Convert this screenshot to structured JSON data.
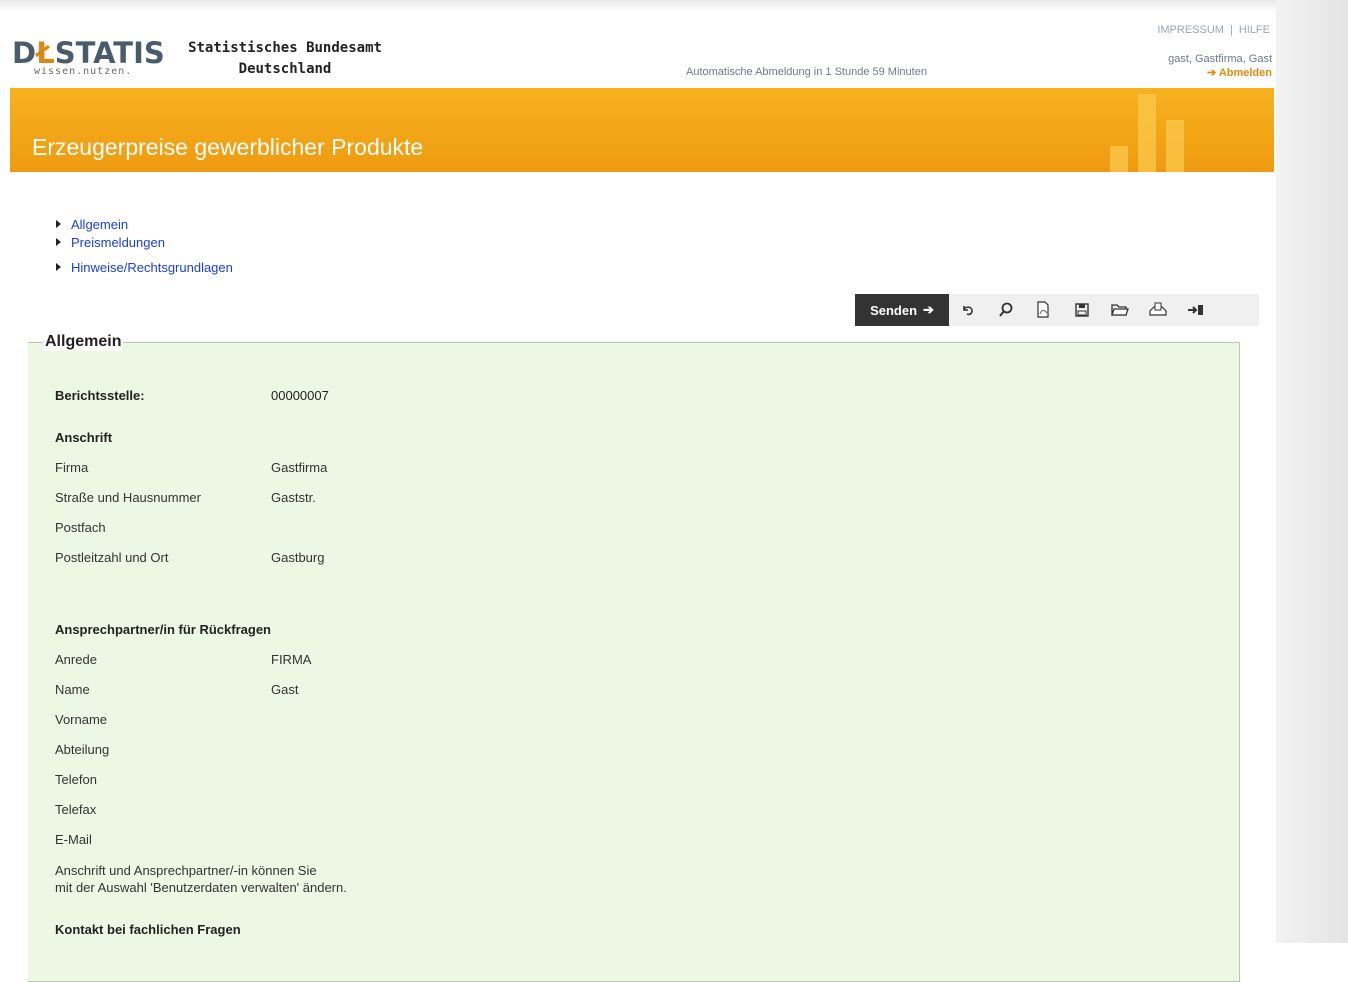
{
  "header": {
    "logo_text_1": "D",
    "logo_text_accent": "Ł",
    "logo_text_2": "STATIS",
    "logo_subtitle": "wissen.nutzen.",
    "org_line1": "Statistisches Bundesamt",
    "org_line2": "Deutschland",
    "impressum": "IMPRESSUM",
    "separator": "|",
    "hilfe": "HILFE",
    "auto_logout": "Automatische Abmeldung in 1 Stunde 59 Minuten",
    "user": "gast, Gastfirma, Gast",
    "logout": "➔ Abmelden"
  },
  "banner": {
    "title": "Erzeugerpreise gewerblicher Produkte"
  },
  "nav": {
    "items": [
      {
        "label": "Allgemein"
      },
      {
        "label": "Preismeldungen"
      },
      {
        "label": "Hinweise/Rechtsgrundlagen"
      }
    ]
  },
  "toolbar": {
    "send_label": "Senden",
    "send_arrow": "➔",
    "undo_icon": "↶",
    "search_icon": "⌕",
    "pdf_icon": "⎗",
    "save_icon": "⊟",
    "open_icon": "❐",
    "print_icon": "⎙",
    "exit_icon": "➜▌"
  },
  "section": {
    "legend": "Allgemein",
    "berichtsstelle_label": "Berichtsstelle:",
    "berichtsstelle_value": "00000007",
    "anschrift_heading": "Anschrift",
    "firma_label": "Firma",
    "firma_value": "Gastfirma",
    "strasse_label": "Straße und Hausnummer",
    "strasse_value": "Gaststr.",
    "postfach_label": "Postfach",
    "postfach_value": "",
    "plz_label": "Postleitzahl und Ort",
    "plz_value": "Gastburg",
    "ansprech_heading": "Ansprechpartner/in für Rückfragen",
    "anrede_label": "Anrede",
    "anrede_value": "FIRMA",
    "name_label": "Name",
    "name_value": "Gast",
    "vorname_label": "Vorname",
    "abteilung_label": "Abteilung",
    "telefon_label": "Telefon",
    "telefax_label": "Telefax",
    "email_label": "E-Mail",
    "note_line1": "Anschrift und Ansprechpartner/-in können Sie",
    "note_line2": "mit der Auswahl 'Benutzerdaten verwalten' ändern.",
    "kontakt_heading": "Kontakt bei fachlichen Fragen"
  }
}
